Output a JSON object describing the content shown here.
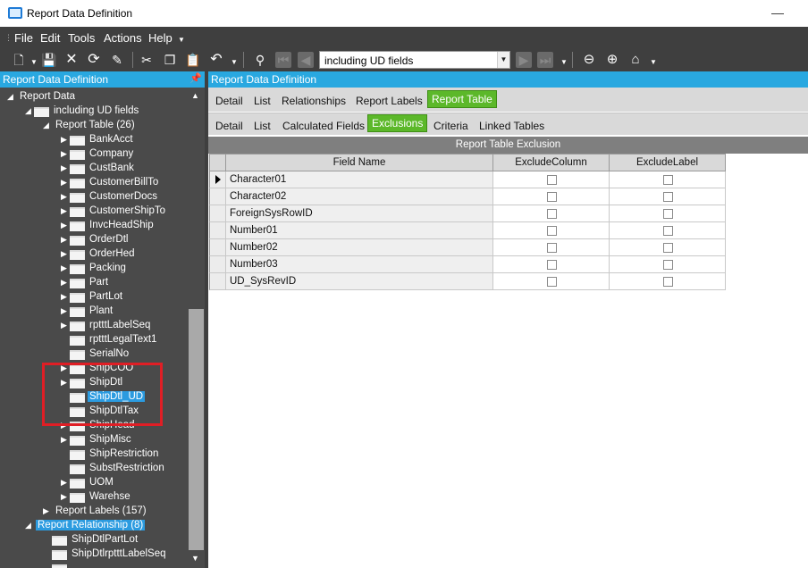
{
  "window": {
    "title": "Report Data Definition"
  },
  "menu": [
    "File",
    "Edit",
    "Tools",
    "Actions",
    "Help"
  ],
  "toolbar": {
    "combo_value": "including UD fields"
  },
  "left_panel": {
    "header": "Report Data Definition",
    "tree": [
      {
        "label": "Report Data",
        "depth": 0,
        "expander": "open",
        "folder": false
      },
      {
        "label": "including UD fields",
        "depth": 1,
        "expander": "open",
        "folder": true
      },
      {
        "label": "Report Table (26)",
        "depth": 2,
        "expander": "open",
        "folder": false
      },
      {
        "label": "BankAcct",
        "depth": 3,
        "expander": "closed",
        "folder": true
      },
      {
        "label": "Company",
        "depth": 3,
        "expander": "closed",
        "folder": true
      },
      {
        "label": "CustBank",
        "depth": 3,
        "expander": "closed",
        "folder": true
      },
      {
        "label": "CustomerBillTo",
        "depth": 3,
        "expander": "closed",
        "folder": true
      },
      {
        "label": "CustomerDocs",
        "depth": 3,
        "expander": "closed",
        "folder": true
      },
      {
        "label": "CustomerShipTo",
        "depth": 3,
        "expander": "closed",
        "folder": true
      },
      {
        "label": "InvcHeadShip",
        "depth": 3,
        "expander": "closed",
        "folder": true
      },
      {
        "label": "OrderDtl",
        "depth": 3,
        "expander": "closed",
        "folder": true
      },
      {
        "label": "OrderHed",
        "depth": 3,
        "expander": "closed",
        "folder": true
      },
      {
        "label": "Packing",
        "depth": 3,
        "expander": "closed",
        "folder": true
      },
      {
        "label": "Part",
        "depth": 3,
        "expander": "closed",
        "folder": true
      },
      {
        "label": "PartLot",
        "depth": 3,
        "expander": "closed",
        "folder": true
      },
      {
        "label": "Plant",
        "depth": 3,
        "expander": "closed",
        "folder": true
      },
      {
        "label": "rptttLabelSeq",
        "depth": 3,
        "expander": "closed",
        "folder": true
      },
      {
        "label": "rptttLegalText1",
        "depth": 3,
        "expander": "none",
        "folder": true
      },
      {
        "label": "SerialNo",
        "depth": 3,
        "expander": "none",
        "folder": true
      },
      {
        "label": "ShipCOO",
        "depth": 3,
        "expander": "closed",
        "folder": true
      },
      {
        "label": "ShipDtl",
        "depth": 3,
        "expander": "closed",
        "folder": true
      },
      {
        "label": "ShipDtl_UD",
        "depth": 3,
        "expander": "none",
        "folder": true,
        "selected": true
      },
      {
        "label": "ShipDtlTax",
        "depth": 3,
        "expander": "none",
        "folder": true
      },
      {
        "label": "ShipHead",
        "depth": 3,
        "expander": "closed",
        "folder": true
      },
      {
        "label": "ShipMisc",
        "depth": 3,
        "expander": "closed",
        "folder": true
      },
      {
        "label": "ShipRestriction",
        "depth": 3,
        "expander": "none",
        "folder": true
      },
      {
        "label": "SubstRestriction",
        "depth": 3,
        "expander": "none",
        "folder": true
      },
      {
        "label": "UOM",
        "depth": 3,
        "expander": "closed",
        "folder": true
      },
      {
        "label": "Warehse",
        "depth": 3,
        "expander": "closed",
        "folder": true
      },
      {
        "label": "Report Labels (157)",
        "depth": 2,
        "expander": "closed",
        "folder": false
      },
      {
        "label": "Report Relationship (8)",
        "depth": 1,
        "expander": "open",
        "folder": false,
        "selected": true
      },
      {
        "label": "ShipDtlPartLot",
        "depth": 2,
        "expander": "none",
        "folder": true
      },
      {
        "label": "ShipDtlrptttLabelSeq",
        "depth": 2,
        "expander": "none",
        "folder": true
      },
      {
        "label": "",
        "depth": 2,
        "expander": "none",
        "folder": true
      }
    ]
  },
  "right_panel": {
    "header": "Report Data Definition",
    "tabs_top": [
      "Detail",
      "List",
      "Relationships",
      "Report Labels",
      "Report Table"
    ],
    "tabs_top_active": 4,
    "tabs_sub": [
      "Detail",
      "List",
      "Calculated Fields",
      "Exclusions",
      "Criteria",
      "Linked Tables"
    ],
    "tabs_sub_active": 3,
    "section_title": "Report Table Exclusion",
    "grid": {
      "columns": [
        "Field Name",
        "ExcludeColumn",
        "ExcludeLabel"
      ],
      "rows": [
        {
          "field": "Character01",
          "exclude_column": false,
          "exclude_label": false,
          "current": true
        },
        {
          "field": "Character02",
          "exclude_column": false,
          "exclude_label": false
        },
        {
          "field": "ForeignSysRowID",
          "exclude_column": false,
          "exclude_label": false
        },
        {
          "field": "Number01",
          "exclude_column": false,
          "exclude_label": false
        },
        {
          "field": "Number02",
          "exclude_column": false,
          "exclude_label": false
        },
        {
          "field": "Number03",
          "exclude_column": false,
          "exclude_label": false
        },
        {
          "field": "UD_SysRevID",
          "exclude_column": false,
          "exclude_label": false
        }
      ]
    }
  },
  "colors": {
    "accent_blue": "#29a8e0",
    "tab_green": "#5cb82a",
    "highlight_red": "#e01e25",
    "toolbar_dark": "#3f3f3f"
  }
}
